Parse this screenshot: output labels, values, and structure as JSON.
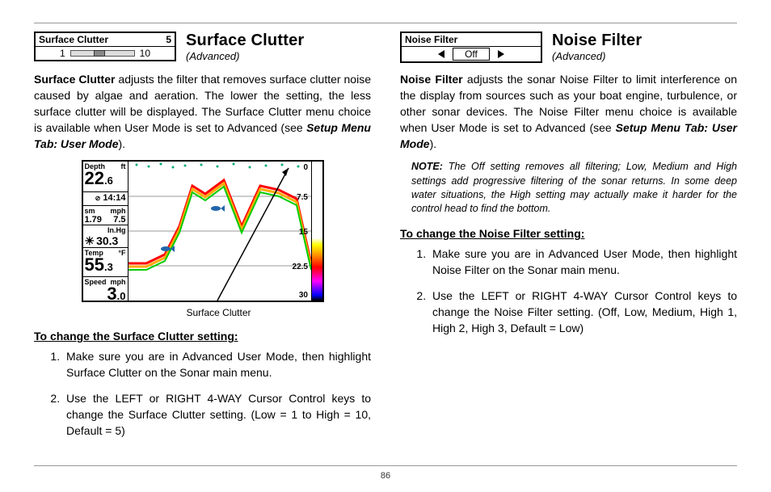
{
  "page_number": "86",
  "left": {
    "menu": {
      "label": "Surface Clutter",
      "value": "5",
      "slider_min": "1",
      "slider_max": "10"
    },
    "title": "Surface Clutter",
    "subtitle": "(Advanced)",
    "body_lead": "Surface Clutter",
    "body_rest": " adjusts the filter that removes surface clutter noise caused by algae and aeration. The lower the setting, the less surface clutter will be displayed. The Surface Clutter menu choice is available when User Mode is set to Advanced (see ",
    "body_bold": "Setup Menu Tab: User Mode",
    "body_tail": ").",
    "caption": "Surface Clutter",
    "subhead": "To change the Surface Clutter setting:",
    "steps": [
      "Make sure you are in Advanced User Mode, then highlight Surface Clutter on the Sonar main menu.",
      "Use the LEFT or RIGHT 4-WAY Cursor Control keys to change the Surface Clutter setting. (Low = 1 to High = 10, Default = 5)"
    ],
    "sonar": {
      "depth_label": "Depth",
      "depth_unit": "ft",
      "depth_big": "22",
      "depth_dec": ".6",
      "time": "14:14",
      "sm_label": "sm",
      "mph_label": "mph",
      "sm_val": "1.79",
      "mph_val": "7.5",
      "inhg": "In.Hg",
      "pressure": "30.3",
      "temp_label": "Temp",
      "temp_unit": "°F",
      "temp_big": "55",
      "temp_dec": ".3",
      "speed_label": "Speed",
      "speed_unit": "mph",
      "speed_big": "3",
      "speed_dec": ".0",
      "ticks": {
        "t0": "0",
        "t1": "7.5",
        "t2": "15",
        "t3": "22.5",
        "t4": "30"
      }
    }
  },
  "right": {
    "menu": {
      "label": "Noise Filter",
      "value": "Off"
    },
    "title": "Noise Filter",
    "subtitle": "(Advanced)",
    "body_lead": "Noise Filter",
    "body_rest": " adjusts the sonar Noise Filter to limit interference on the display from sources such as your boat engine, turbulence, or other sonar devices. The Noise Filter menu choice is available when User Mode is set to Advanced (see ",
    "body_bold": "Setup Menu Tab: User Mode",
    "body_tail": ").",
    "note_lead": "NOTE:  ",
    "note_rest": "The Off setting removes all filtering; Low, Medium and High settings add progressive filtering of the sonar returns. In some deep water situations, the High setting may actually make it harder for the control head to find the bottom.",
    "subhead": "To change the Noise Filter setting:",
    "steps": [
      "Make sure you are in Advanced User Mode, then highlight Noise Filter on the Sonar main menu.",
      "Use the LEFT or RIGHT 4-WAY Cursor Control keys to change the Noise Filter setting. (Off, Low, Medium, High 1, High 2, High 3, Default = Low)"
    ]
  },
  "chart_data": {
    "type": "line",
    "title": "Surface Clutter",
    "ylabel": "Depth (ft)",
    "ylim": [
      0,
      30
    ],
    "yticks": [
      0,
      7.5,
      15,
      22.5,
      30
    ],
    "x": [
      0,
      10,
      20,
      28,
      35,
      42,
      52,
      62,
      72,
      82,
      92,
      100
    ],
    "values": [
      22,
      22,
      20,
      14,
      5,
      7,
      4,
      14,
      5,
      6,
      8,
      22
    ],
    "overlay_readouts": {
      "depth_ft": 22.6,
      "time": "14:14",
      "trip_sm": 1.79,
      "speed_mph": 7.5,
      "pressure_inhg": 30.3,
      "temp_f": 55.3,
      "speed2_mph": 3.0
    }
  }
}
